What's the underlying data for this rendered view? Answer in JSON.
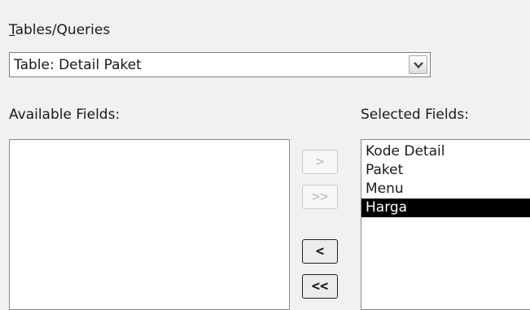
{
  "source": {
    "label_mnemonic": "T",
    "label_rest": "ables/Queries",
    "selected_value": "Table: Detail Paket"
  },
  "available": {
    "label": "Available Fields:",
    "items": []
  },
  "selected": {
    "label": "Selected Fields:",
    "items": [
      "Kode Detail",
      "Paket",
      "Menu",
      "Harga"
    ],
    "highlighted": "Harga"
  },
  "buttons": {
    "add_one": ">",
    "add_all": ">>",
    "remove_one": "<",
    "remove_all": "<<"
  }
}
